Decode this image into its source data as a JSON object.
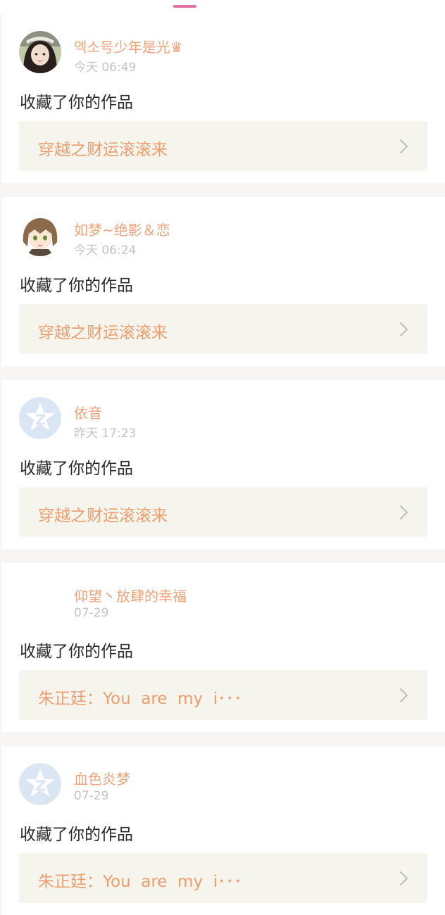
{
  "feed": {
    "items": [
      {
        "username": "엑소号少年是光♛",
        "time": "今天 06:49",
        "action": "收藏了你的作品",
        "work_title": "穿越之财运滚滚来",
        "avatar": "photo-girl-hat"
      },
      {
        "username": "如梦~绝影＆恋",
        "time": "今天 06:24",
        "action": "收藏了你的作品",
        "work_title": "穿越之财运滚滚来",
        "avatar": "anime-girl"
      },
      {
        "username": "依音",
        "time": "昨天 17:23",
        "action": "收藏了你的作品",
        "work_title": "穿越之财运滚滚来",
        "avatar": "default-star"
      },
      {
        "username": "仰望丶放肆的幸福",
        "time": "07-29",
        "action": "收藏了你的作品",
        "work_title": "朱正廷：You  are  my  i･･･",
        "avatar": "blank"
      },
      {
        "username": "血色炎梦",
        "time": "07-29",
        "action": "收藏了你的作品",
        "work_title": "朱正廷：You  are  my  i･･･",
        "avatar": "default-star"
      }
    ]
  },
  "colors": {
    "username": "#f0a27a",
    "work_title": "#ef9d6d",
    "work_bg": "#f5f5ee",
    "time": "#c4c4c4",
    "action": "#2b2b2b",
    "indicator": "#e46fa6",
    "default_avatar": "#dbe6f4"
  }
}
